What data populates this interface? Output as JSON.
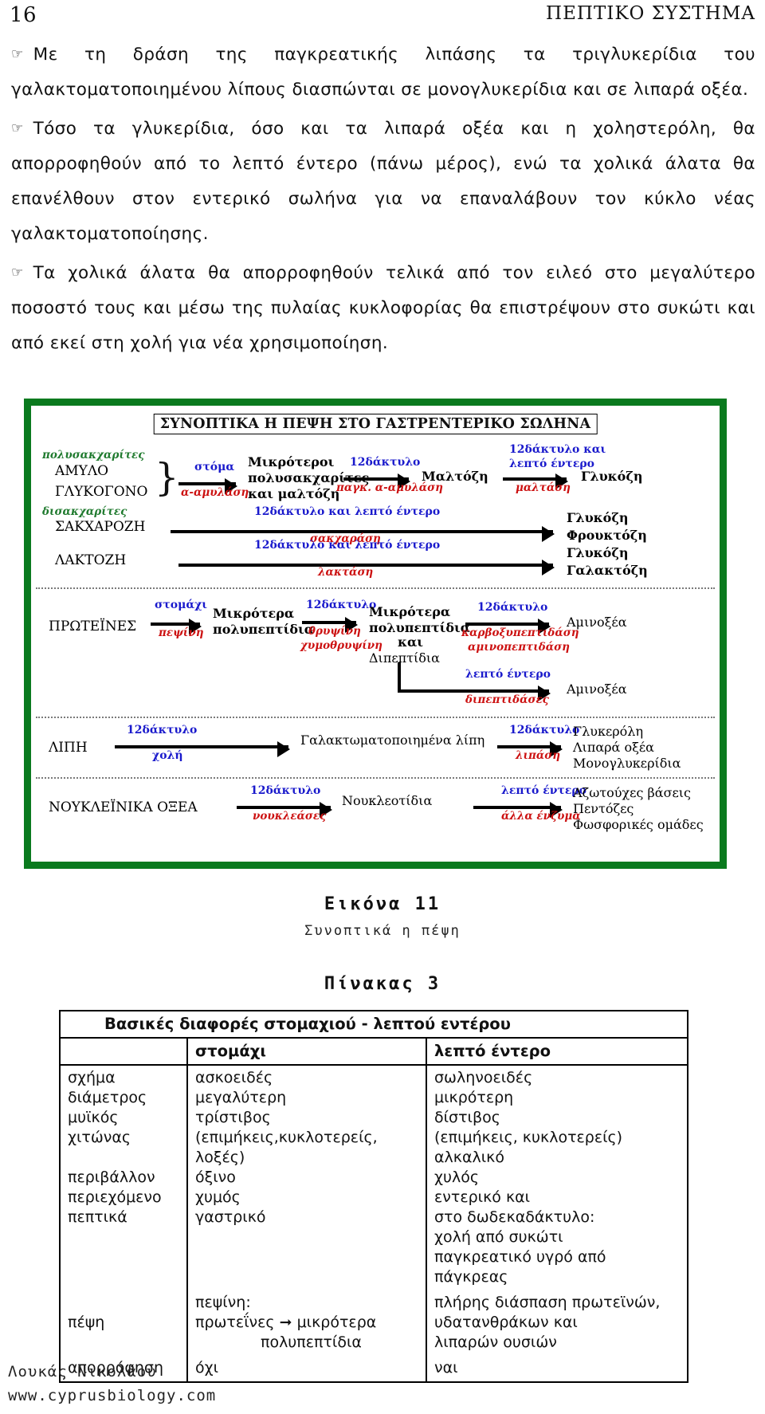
{
  "header": {
    "page_number": "16",
    "running_title": "ΠΕΠΤΙΚΟ ΣΥΣΤΗΜΑ"
  },
  "body": {
    "bullet_glyph": "☞",
    "paragraphs": [
      "Με τη δράση της παγκρεατικής λιπάσης τα τριγλυκερίδια του γαλακτοματοποιημένου λίπους διασπώνται σε μονογλυκερίδια και σε λιπαρά οξέα.",
      "Τόσο τα γλυκερίδια, όσο και τα λιπαρά οξέα και η χοληστερόλη, θα απορροφηθούν από το λεπτό έντερο (πάνω μέρος), ενώ τα χολικά άλατα θα επανέλθουν στον εντερικό σωλήνα για να επαναλάβουν τον κύκλο νέας γαλακτοματοποίησης.",
      "Τα χολικά άλατα θα απορροφηθούν τελικά από τον ειλεό στο μεγαλύτερο ποσοστό τους και μέσω της πυλαίας κυκλοφορίας θα επιστρέψουν στο συκώτι και από εκεί στη χολή για νέα χρησιμοποίηση."
    ]
  },
  "figure": {
    "frame_color": "#0a7a1e",
    "title": "ΣΥΝΟΠΤΙΚΑ Η ΠΕΨΗ ΣΤΟ ΓΑΣΤΡΕΝΤΕΡΙΚΟ ΣΩΛΗΝΑ",
    "colors": {
      "class_label": "#1f7a2e",
      "site_label": "#1a1acc",
      "enzyme_label": "#cc1111",
      "substrate": "#000000"
    },
    "carbohydrates": {
      "class_polysaccharides": "πολυσακχαρίτες",
      "substrate_starch": "ΑΜΥΛΟ",
      "substrate_glycogen": "ΓΛΥΚΟΓΟΝΟ",
      "step1_site": "στόμα",
      "step1_enzyme": "α-αμυλάση",
      "product1_line1": "Μικρότεροι",
      "product1_line2": "πολυσακχαρίτες",
      "product1_line3": "και μαλτόζη",
      "step2_site": "12δάκτυλο",
      "step2_enzyme": "παγκ. α-αμυλάση",
      "product2": "Μαλτόζη",
      "step3_site_line1": "12δάκτυλο και",
      "step3_site_line2": "λεπτό έντερο",
      "step3_enzyme": "μαλτάση",
      "product3": "Γλυκόζη",
      "class_disaccharides": "δισακχαρίτες",
      "substrate_sucrose": "ΣΑΚΧΑΡΟΖΗ",
      "sucrose_site": "12δάκτυλο και λεπτό έντερο",
      "sucrose_enzyme": "σακχαράση",
      "sucrose_product1": "Γλυκόζη",
      "sucrose_product2": "Φρουκτόζη",
      "substrate_lactose": "ΛΑΚΤΟΖΗ",
      "lactose_site": "12δάκτυλο και λεπτό έντερο",
      "lactose_enzyme": "λακτάση",
      "lactose_product1": "Γλυκόζη",
      "lactose_product2": "Γαλακτόζη"
    },
    "proteins": {
      "substrate": "ΠΡΩΤΕΪΝΕΣ",
      "step1_site": "στομάχι",
      "step1_enzyme": "πεψίνη",
      "product1_line1": "Μικρότερα",
      "product1_line2": "πολυπεπτίδια",
      "step2_site": "12δάκτυλο",
      "step2_enzyme_line1": "θρυψίνη",
      "step2_enzyme_line2": "χυμοθρυψίνη",
      "product2_line1": "Μικρότερα",
      "product2_line2": "πολυπεπτίδια",
      "product2_line3": "και",
      "product2_line4": "Διπεπτίδια",
      "step3_site": "12δάκτυλο",
      "step3_enzyme_line1": "καρβοξυπεπτιδάση",
      "step3_enzyme_line2": "αμινοπεπτιδάση",
      "product3": "Αμινοξέα",
      "step4_site": "λεπτό έντερο",
      "step4_enzyme": "διπεπτιδάσες",
      "product4": "Αμινοξέα"
    },
    "lipids": {
      "substrate": "ΛΙΠΗ",
      "step1_site": "12δάκτυλο",
      "step1_enzyme": "χολή",
      "product1": "Γαλακτωματοποιημένα λίπη",
      "step2_site": "12δάκτυλο",
      "step2_enzyme": "λιπάση",
      "product2_line1": "Γλυκερόλη",
      "product2_line2": "Λιπαρά οξέα",
      "product2_line3": "Μονογλυκερίδια"
    },
    "nucleic_acids": {
      "substrate": "ΝΟΥΚΛΕΪΝΙΚΑ ΟΞΕΑ",
      "step1_site": "12δάκτυλο",
      "step1_enzyme": "νουκλεάσες",
      "product1": "Νουκλεοτίδια",
      "step2_site": "λεπτό έντερο",
      "step2_enzyme": "άλλα ένζυμα",
      "product2_line1": "Αζωτούχες βάσεις",
      "product2_line2": "Πεντόζες",
      "product2_line3": "Φωσφορικές ομάδες"
    }
  },
  "figure_caption": {
    "label": "Εικόνα 11",
    "description": "Συνοπτικά η πέψη"
  },
  "table_caption": {
    "label": "Πίνακας 3"
  },
  "table": {
    "title": "Βασικές διαφορές στομαχιού - λεπτού εντέρου",
    "columns": [
      "",
      "στομάχι",
      "λεπτό έντερο"
    ],
    "rows": [
      {
        "attributes": [
          "σχήμα",
          "διάμετρος",
          "μυϊκός χιτώνας",
          "",
          "περιβάλλον",
          "περιεχόμενο",
          "πεπτικά"
        ],
        "stomach": [
          "ασκοειδές",
          "μεγαλύτερη",
          "τρίστιβος",
          "(επιμήκεις,κυκλοτερείς, λοξές)",
          "όξινο",
          "χυμός",
          "γαστρικό"
        ],
        "intestine": [
          "σωληνοειδές",
          "μικρότερη",
          "δίστιβος",
          "(επιμήκεις, κυκλοτερείς)",
          "αλκαλικό",
          "χυλός",
          "εντερικό και",
          "στο δωδεκαδάκτυλο:",
          "χολή από συκώτι",
          "παγκρεατικό υγρό από πάγκρεας"
        ]
      },
      {
        "attribute": "πέψη",
        "stomach_line1": "πεψίνη:",
        "stomach_line2": "πρωτεΐνες ➞ μικρότερα",
        "stomach_line3": "πολυπεπτίδια",
        "intestine_line1": "πλήρης διάσπαση  πρωτεϊνών,",
        "intestine_line2": "υδατανθράκων και",
        "intestine_line3": "λιπαρών ουσιών"
      },
      {
        "attribute": "απορρόφηση",
        "stomach": "όχι",
        "intestine": "ναι"
      }
    ]
  },
  "footer": {
    "author": "Λουκάς Νικολάου",
    "website": "www.cyprusbiology.com"
  }
}
